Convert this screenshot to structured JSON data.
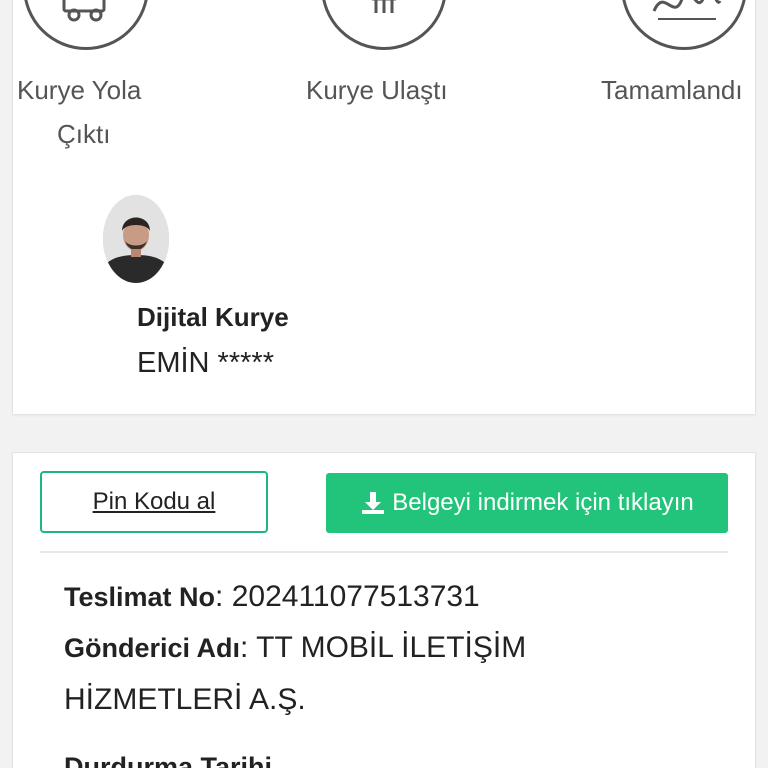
{
  "steps": [
    {
      "label": "Kurye Yola",
      "label2": "Çıktı",
      "icon": "delivery-truck-icon"
    },
    {
      "label": "Kurye Ulaştı",
      "icon": "fork-icon"
    },
    {
      "label": "Tamamlandı",
      "icon": "signature-icon"
    }
  ],
  "courier": {
    "title": "Dijital Kurye",
    "name": "EMİN *****"
  },
  "actions": {
    "pin_label": "Pin Kodu al",
    "download_label": "Belgeyi indirmek için tıklayın"
  },
  "details": {
    "delivery_no_label": "Teslimat No",
    "delivery_no_value": ": 202411077513731",
    "sender_label": "Gönderici Adı",
    "sender_value_line1": ": TT MOBİL İLETİŞİM",
    "sender_value_line2": "HİZMETLERİ A.Ş.",
    "next_label_partial": "Durdurma Tarihi"
  },
  "colors": {
    "accent_green": "#21c47a",
    "border_green": "#1db488",
    "icon_gray": "#555555"
  }
}
